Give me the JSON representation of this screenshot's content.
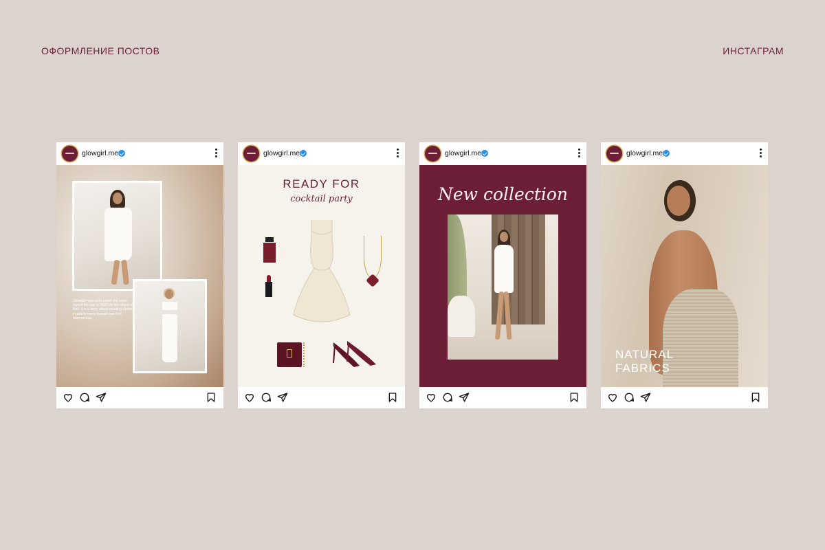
{
  "header": {
    "left": "ОФОРМЛЕНИЕ ПОСТОВ",
    "right": "ИНСТАГРАМ"
  },
  "colors": {
    "background": "#ddd3ce",
    "accent": "#6b1e35",
    "verified": "#2d8ee8"
  },
  "posts": [
    {
      "username": "glowgirl.me",
      "body_text": "GlowGirl was born under the warm raysof the sun in 2020 on the island of Bali. It is a story about creating clothes in which every woman can feel harmonious.",
      "icons": [
        "heart-icon",
        "comment-icon",
        "share-icon",
        "bookmark-icon"
      ]
    },
    {
      "username": "glowgirl.me",
      "title_line1": "READY FOR",
      "title_line2": "cocktail party",
      "icons": [
        "heart-icon",
        "comment-icon",
        "share-icon",
        "bookmark-icon"
      ]
    },
    {
      "username": "glowgirl.me",
      "title": "New collection",
      "icons": [
        "heart-icon",
        "comment-icon",
        "share-icon",
        "bookmark-icon"
      ]
    },
    {
      "username": "glowgirl.me",
      "title_line1": "NATURAL",
      "title_line2": "FABRICS",
      "icons": [
        "heart-icon",
        "comment-icon",
        "share-icon",
        "bookmark-icon"
      ]
    }
  ]
}
